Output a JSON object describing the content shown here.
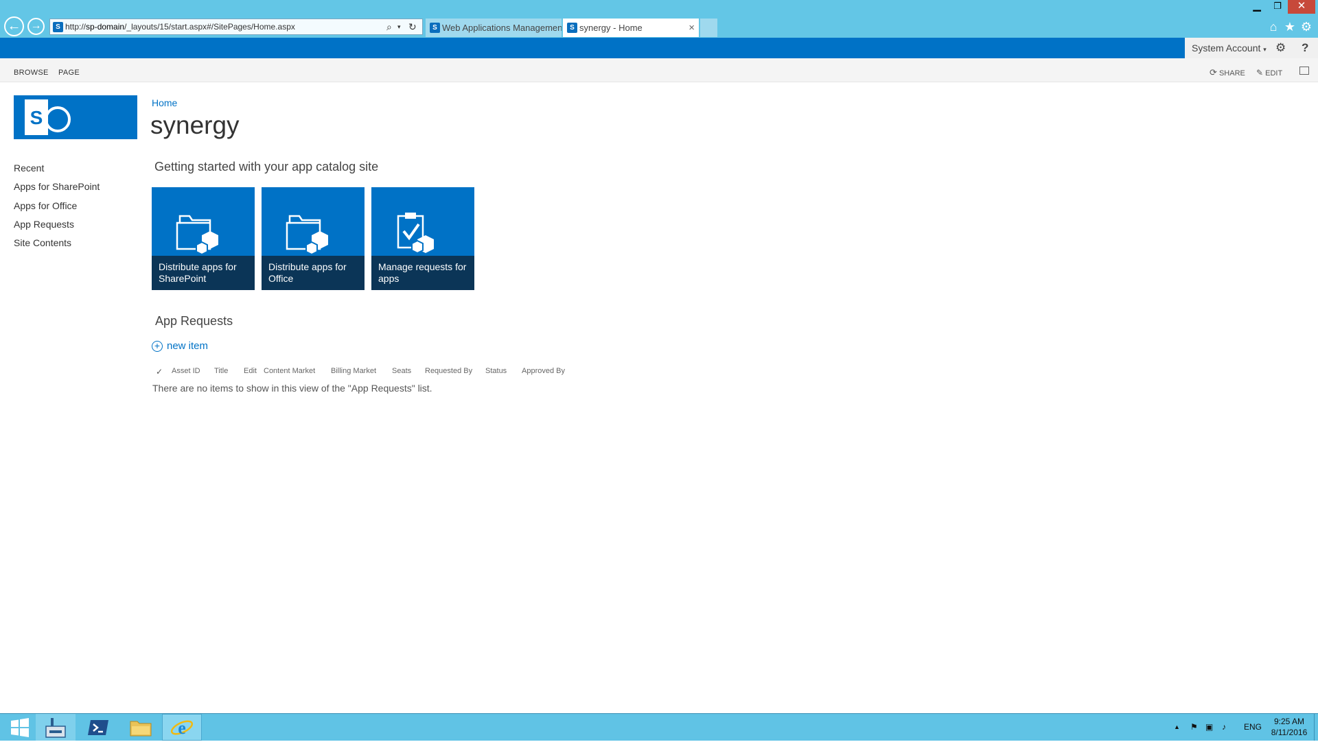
{
  "browser": {
    "url_host": "sp-domain",
    "url_path": "/_layouts/15/start.aspx#/SitePages/Home.aspx",
    "url_prefix": "http://",
    "tabs": [
      {
        "label": "Web Applications Management",
        "active": false
      },
      {
        "label": "synergy - Home",
        "active": true
      }
    ],
    "close_tab_glyph": "×"
  },
  "suite_bar": {
    "account_label": "System Account",
    "settings_icon": "gear-icon",
    "help_label": "?"
  },
  "ribbon": {
    "tabs": [
      "BROWSE",
      "PAGE"
    ],
    "share_label": "SHARE",
    "edit_label": "EDIT"
  },
  "site": {
    "breadcrumb": "Home",
    "title": "synergy",
    "logo_letter": "S"
  },
  "left_nav": [
    "Recent",
    "Apps for SharePoint",
    "Apps for Office",
    "App Requests",
    "Site Contents"
  ],
  "getting_started": {
    "heading": "Getting started with your app catalog site",
    "tiles": [
      {
        "line1": "Distribute apps for",
        "line2": "SharePoint",
        "icon": "folder-apps-icon"
      },
      {
        "line1": "Distribute apps for",
        "line2": "Office",
        "icon": "folder-apps-icon"
      },
      {
        "line1": "Manage requests for",
        "line2": "apps",
        "icon": "clipboard-check-icon"
      }
    ]
  },
  "app_requests": {
    "heading": "App Requests",
    "new_item_label": "new item",
    "columns": [
      "Asset ID",
      "Title",
      "Edit",
      "Content Market",
      "Billing Market",
      "Seats",
      "Requested By",
      "Status",
      "Approved By"
    ],
    "empty_message": "There are no items to show in this view of the \"App Requests\" list."
  },
  "taskbar": {
    "language": "ENG",
    "time": "9:25 AM",
    "date": "8/11/2016"
  },
  "colors": {
    "accent": "#0072c6",
    "tile_caption": "#0b3557",
    "browser_chrome": "#63c6e6"
  }
}
